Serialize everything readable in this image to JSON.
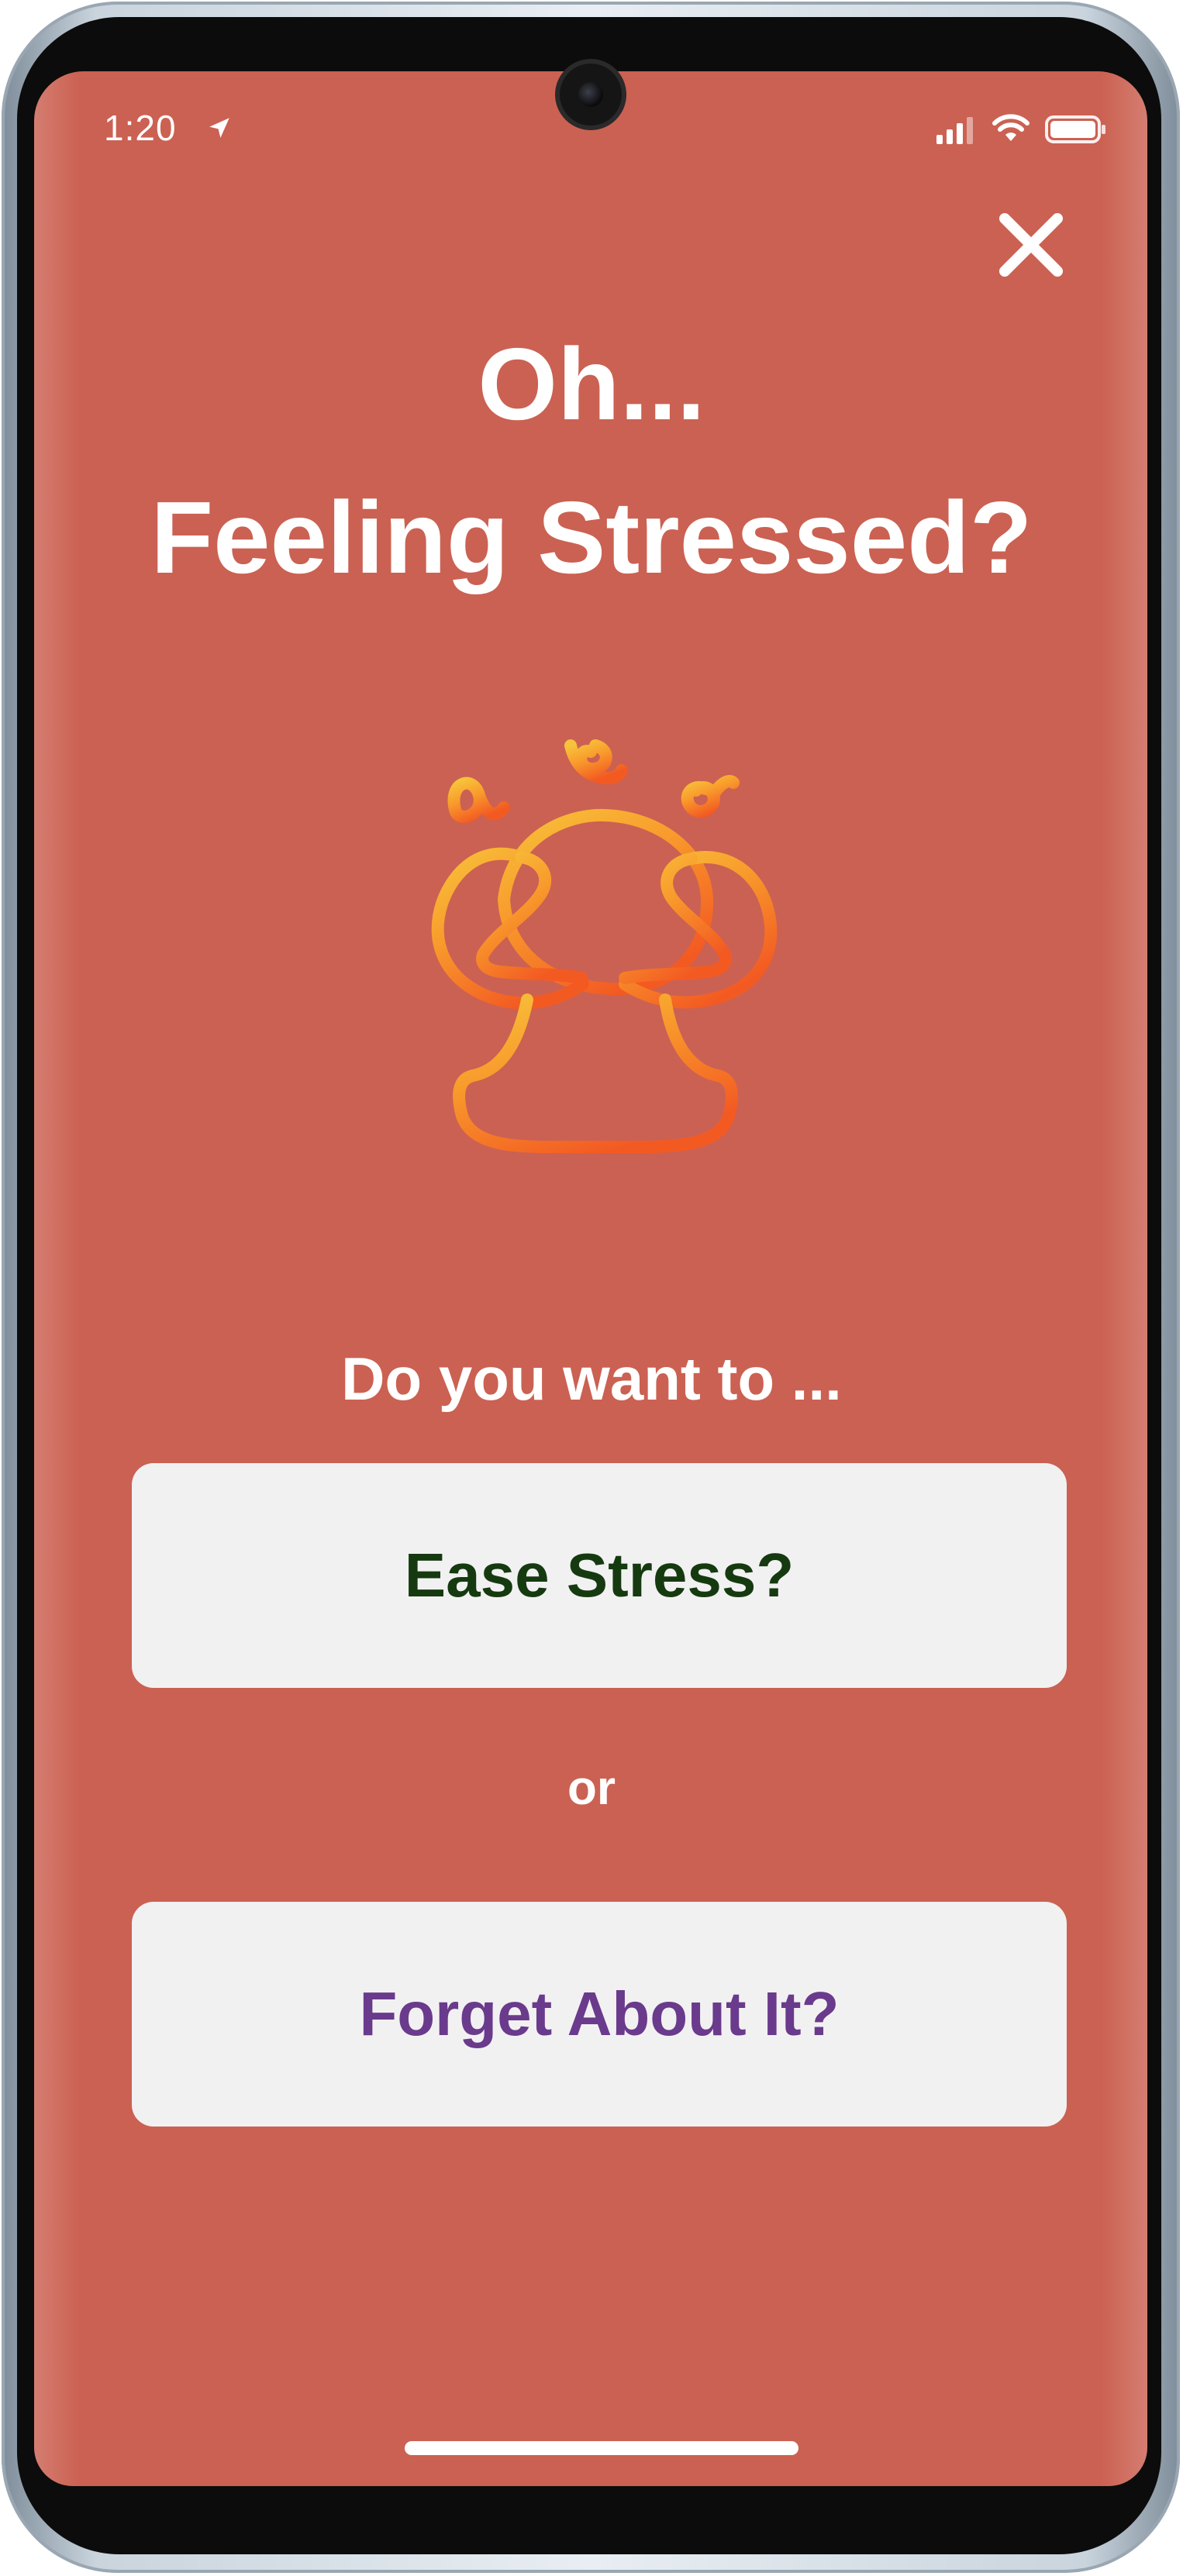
{
  "status_bar": {
    "time": "1:20",
    "icons": [
      "location-arrow-icon",
      "cellular-signal-icon",
      "wifi-icon",
      "battery-icon"
    ]
  },
  "screen": {
    "background_color": "#cb6152",
    "close_icon": "close-icon",
    "title_line1": "Oh...",
    "title_line2": "Feeling Stressed?",
    "illustration": "stressed-person-icon",
    "prompt": "Do you want to ...",
    "option_ease": {
      "label": "Ease Stress?",
      "color": "#163a10"
    },
    "separator": "or",
    "option_forget": {
      "label": "Forget About It?",
      "color": "#6a3a8c"
    }
  }
}
